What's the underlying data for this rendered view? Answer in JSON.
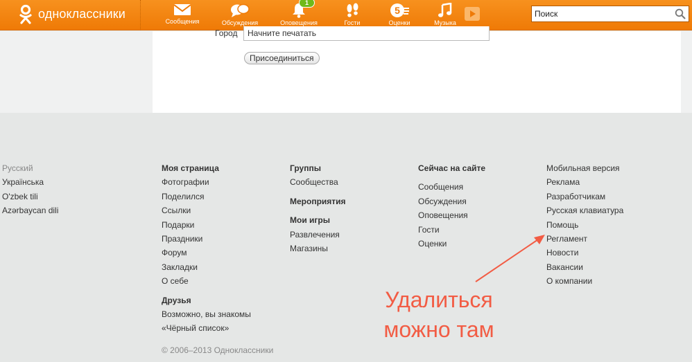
{
  "header": {
    "logo_text": "одноклассники",
    "nav": [
      {
        "icon": "envelope-icon",
        "label": "Сообщения"
      },
      {
        "icon": "chat-bubbles-icon",
        "label": "Обсуждения"
      },
      {
        "icon": "bell-icon",
        "label": "Оповещения",
        "badge": "1"
      },
      {
        "icon": "footprints-icon",
        "label": "Гости"
      },
      {
        "icon": "rating-5-icon",
        "label": "Оценки"
      },
      {
        "icon": "music-note-icon",
        "label": "Музыка"
      }
    ],
    "search": {
      "placeholder": "Поиск"
    },
    "colors": {
      "bar": "#f7911e",
      "badge": "#6fb91a"
    }
  },
  "form": {
    "city_label": "Город",
    "city_placeholder": "Начните печатать",
    "join_button": "Присоединиться"
  },
  "footer": {
    "languages": [
      "Русский",
      "Українська",
      "O'zbek tili",
      "Azərbaycan dili"
    ],
    "my_page": {
      "heading": "Моя страница",
      "links": [
        "Фотографии",
        "Поделился",
        "Ссылки",
        "Подарки",
        "Праздники",
        "Форум",
        "Закладки",
        "О себе"
      ]
    },
    "friends": {
      "heading": "Друзья",
      "links": [
        "Возможно, вы знакомы",
        "«Чёрный список»"
      ]
    },
    "groups_heading": "Группы",
    "communities": "Сообщества",
    "events_heading": "Мероприятия",
    "games_heading": "Мои игры",
    "games_links": [
      "Развлечения",
      "Магазины"
    ],
    "now_on_site": {
      "heading": "Сейчас на сайте",
      "links": [
        "Сообщения",
        "Обсуждения",
        "Оповещения",
        "Гости",
        "Оценки"
      ]
    },
    "service_links": [
      "Мобильная версия",
      "Реклама",
      "Разработчикам",
      "Русская клавиатура",
      "Помощь",
      "Регламент",
      "Новости",
      "Вакансии",
      "О компании"
    ],
    "copyright": "© 2006–2013 Одноклассники"
  },
  "annotation": {
    "line1": "Удалиться",
    "line2": "можно там",
    "color": "#f25c44"
  }
}
